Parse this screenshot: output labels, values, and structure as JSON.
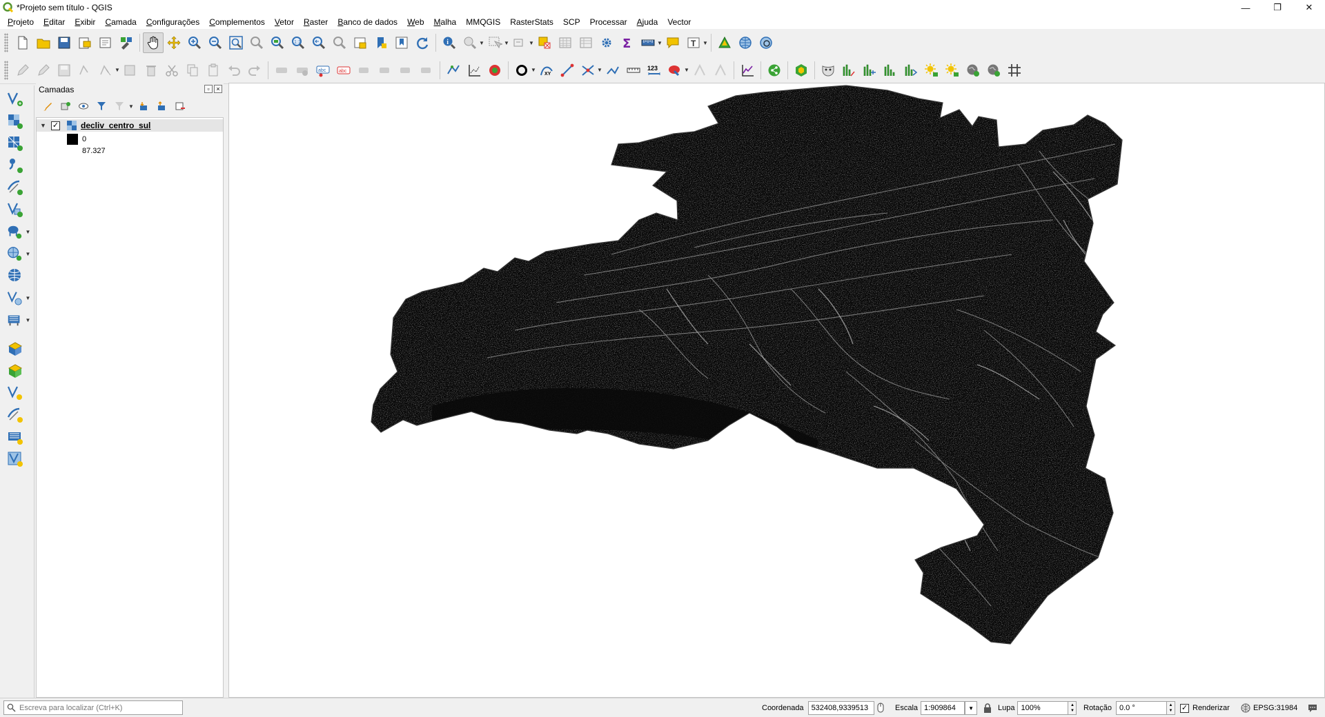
{
  "window": {
    "title": "*Projeto sem título - QGIS",
    "controls": [
      "—",
      "❐",
      "✕"
    ]
  },
  "menubar": [
    {
      "label": "Projeto",
      "accel": "P",
      "rest": "rojeto"
    },
    {
      "label": "Editar",
      "accel": "E",
      "rest": "ditar"
    },
    {
      "label": "Exibir",
      "accel": "E",
      "rest": "xibir"
    },
    {
      "label": "Camada",
      "accel": "C",
      "rest": "amada"
    },
    {
      "label": "Configurações",
      "accel": "C",
      "rest": "onfigurações"
    },
    {
      "label": "Complementos",
      "accel": "C",
      "rest": "omplementos"
    },
    {
      "label": "Vetor",
      "accel": "V",
      "rest": "etor"
    },
    {
      "label": "Raster",
      "accel": "R",
      "rest": "aster"
    },
    {
      "label": "Banco de dados",
      "accel": "B",
      "rest": "anco de dados"
    },
    {
      "label": "Web",
      "accel": "W",
      "rest": "eb"
    },
    {
      "label": "Malha",
      "accel": "M",
      "rest": "alha"
    },
    {
      "label": "MMQGIS",
      "accel": "",
      "rest": "MMQGIS"
    },
    {
      "label": "RasterStats",
      "accel": "",
      "rest": "RasterStats"
    },
    {
      "label": "SCP",
      "accel": "",
      "rest": "SCP"
    },
    {
      "label": "Processar",
      "accel": "",
      "rest": "Processar"
    },
    {
      "label": "Ajuda",
      "accel": "A",
      "rest": "juda"
    },
    {
      "label": "Vector",
      "accel": "",
      "rest": "Vector"
    }
  ],
  "layers_panel": {
    "title": "Camadas",
    "layer": {
      "name": "decliv_centro_sul",
      "checked": true,
      "legend_min": "0",
      "legend_max": "87.327"
    }
  },
  "statusbar": {
    "locator_placeholder": "Escreva para localizar (Ctrl+K)",
    "coordinate_label": "Coordenada",
    "coordinate_value": "532408,9339513",
    "scale_label": "Escala",
    "scale_value": "1:909864",
    "magnifier_label": "Lupa",
    "magnifier_value": "100%",
    "rotation_label": "Rotação",
    "rotation_value": "0.0 °",
    "render_label": "Renderizar",
    "render_checked": true,
    "crs": "EPSG:31984"
  },
  "colors": {
    "accent_yellow": "#f2c300",
    "accent_blue": "#2f6fb5",
    "accent_green": "#3aa335",
    "raster_fill": "#060606"
  }
}
